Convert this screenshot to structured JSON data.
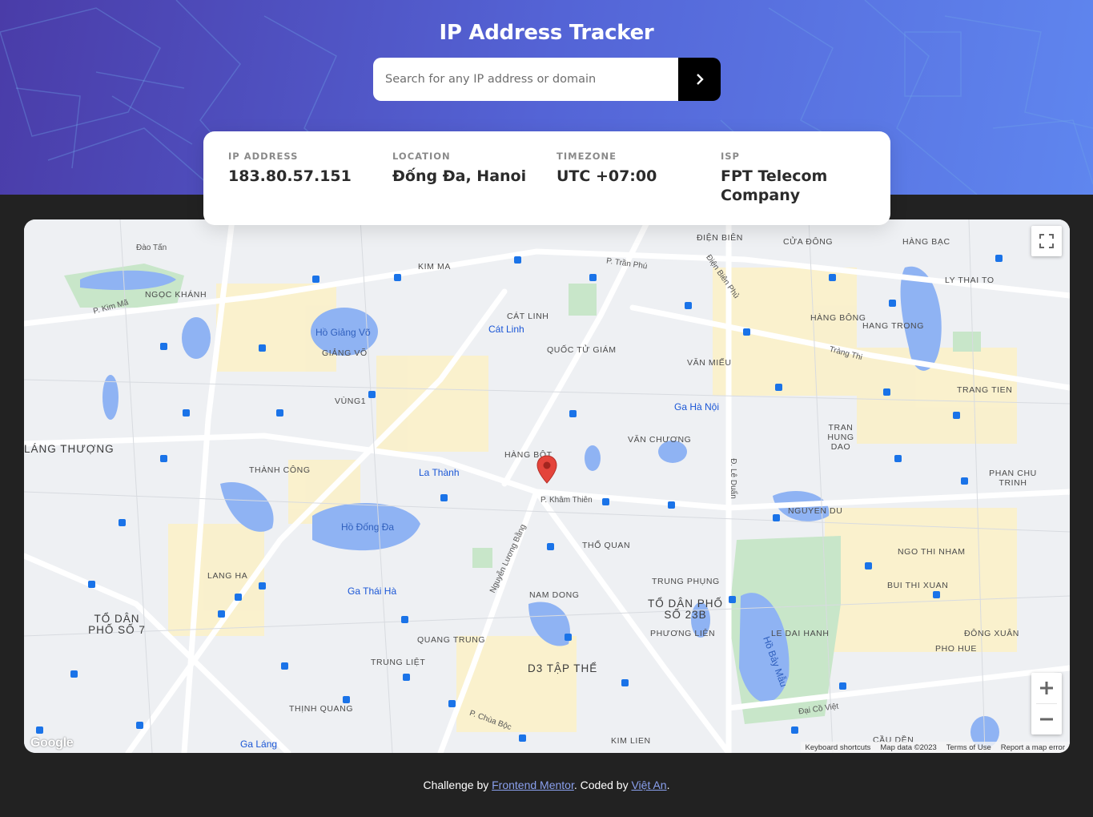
{
  "header": {
    "title": "IP Address Tracker",
    "search_placeholder": "Search for any IP address or domain",
    "search_value": ""
  },
  "info": {
    "ip": {
      "label": "IP ADDRESS",
      "value": "183.80.57.151"
    },
    "location": {
      "label": "LOCATION",
      "value": "Đống Đa, Hanoi"
    },
    "timezone": {
      "label": "TIMEZONE",
      "value": "UTC +07:00"
    },
    "isp": {
      "label": "ISP",
      "value": "FPT Telecom Company"
    }
  },
  "map": {
    "labels": {
      "kim_ma": "KIM MA",
      "ngoc_khanh": "NGỌC KHÁNH",
      "dao_tan": "Đào Tấn",
      "cat_linh_area": "CÁT LINH",
      "cat_linh_station": "Cát Linh",
      "quoc_tu_giam": "QUỐC TỬ GIÁM",
      "ho_giang_vo": "Hồ Giảng Võ",
      "giang_vo": "GIẢNG VÕ",
      "van_mieu": "VĂN MIẾU",
      "ga_ha_noi": "Ga Hà Nội",
      "dien_bien": "ĐIỆN BIÊN",
      "cua_dong": "CỬA ĐÔNG",
      "hang_bac": "HÀNG BẠC",
      "ly_thai_to": "LY THAI TO",
      "hang_bong": "HÀNG BÔNG",
      "hang_trong": "HANG TRONG",
      "trang_tien": "TRANG TIEN",
      "tran_hung_dao": "TRAN HUNG DAO",
      "phan_chu_trinh": "PHAN CHU TRINH",
      "vung1": "VÙNG1",
      "lang_thuong": "LÁNG THƯỢNG",
      "thanh_cong": "THÀNH CÔNG",
      "la_thanh": "La Thành",
      "hang_bot": "HÀNG BỘT",
      "van_chuong": "VĂN CHƯƠNG",
      "nguyen_du": "NGUYEN DU",
      "ngo_thi_nham": "NGO THI NHAM",
      "ho_dong_da": "Hồ Đống Đa",
      "lang_ha": "LANG HA",
      "tho_quan": "THỔ QUAN",
      "trung_phung": "TRUNG PHỤNG",
      "bui_thi_xuan": "BUI THI XUAN",
      "ga_thai_ha": "Ga Thái Hà",
      "nam_dong": "NAM DONG",
      "to_dan_pho_23b": "TỔ DÂN PHỐ SỐ 23B",
      "to_dan_pho_7": "TỔ DÂN PHỐ SỐ 7",
      "le_dai_hanh": "LE DAI HANH",
      "dong_xuan": "ĐÔNG XUÂN",
      "quang_trung": "QUANG TRUNG",
      "phuong_lien": "PHƯƠNG LIÊN",
      "pho_hue": "PHO HUE",
      "trung_liet": "TRUNG LIỆT",
      "d3_tap_the": "D3 TẬP THỂ",
      "thinh_quang": "THỊNH QUANG",
      "kim_lien": "KIM LIEN",
      "cau_den": "CẦU DỀN",
      "ga_lang": "Ga Láng",
      "ho_bay_mau": "Hồ Bảy Mẫu",
      "p_tran_phu": "P. Trần Phú",
      "trang_thi": "Tràng Thi",
      "nguyen_luong_bang": "Nguyễn Lương Bằng",
      "p_kham_thien": "P. Khâm Thiên",
      "p_chua_boc": "P. Chùa Bộc",
      "dai_co_viet": "Đại Cồ Việt",
      "dien_bien_phu": "Điện Biên Phủ",
      "p_kim_ma": "P. Kim Mã",
      "d_le_duan": "Đ. Lê Duẩn"
    },
    "attribution": {
      "keyboard": "Keyboard shortcuts",
      "data": "Map data ©2023",
      "terms": "Terms of Use",
      "report": "Report a map error"
    },
    "logo": "Google"
  },
  "footer": {
    "prefix": "Challenge by ",
    "link1": "Frontend Mentor",
    "middle": ". Coded by ",
    "link2": "Việt An",
    "suffix": "."
  }
}
